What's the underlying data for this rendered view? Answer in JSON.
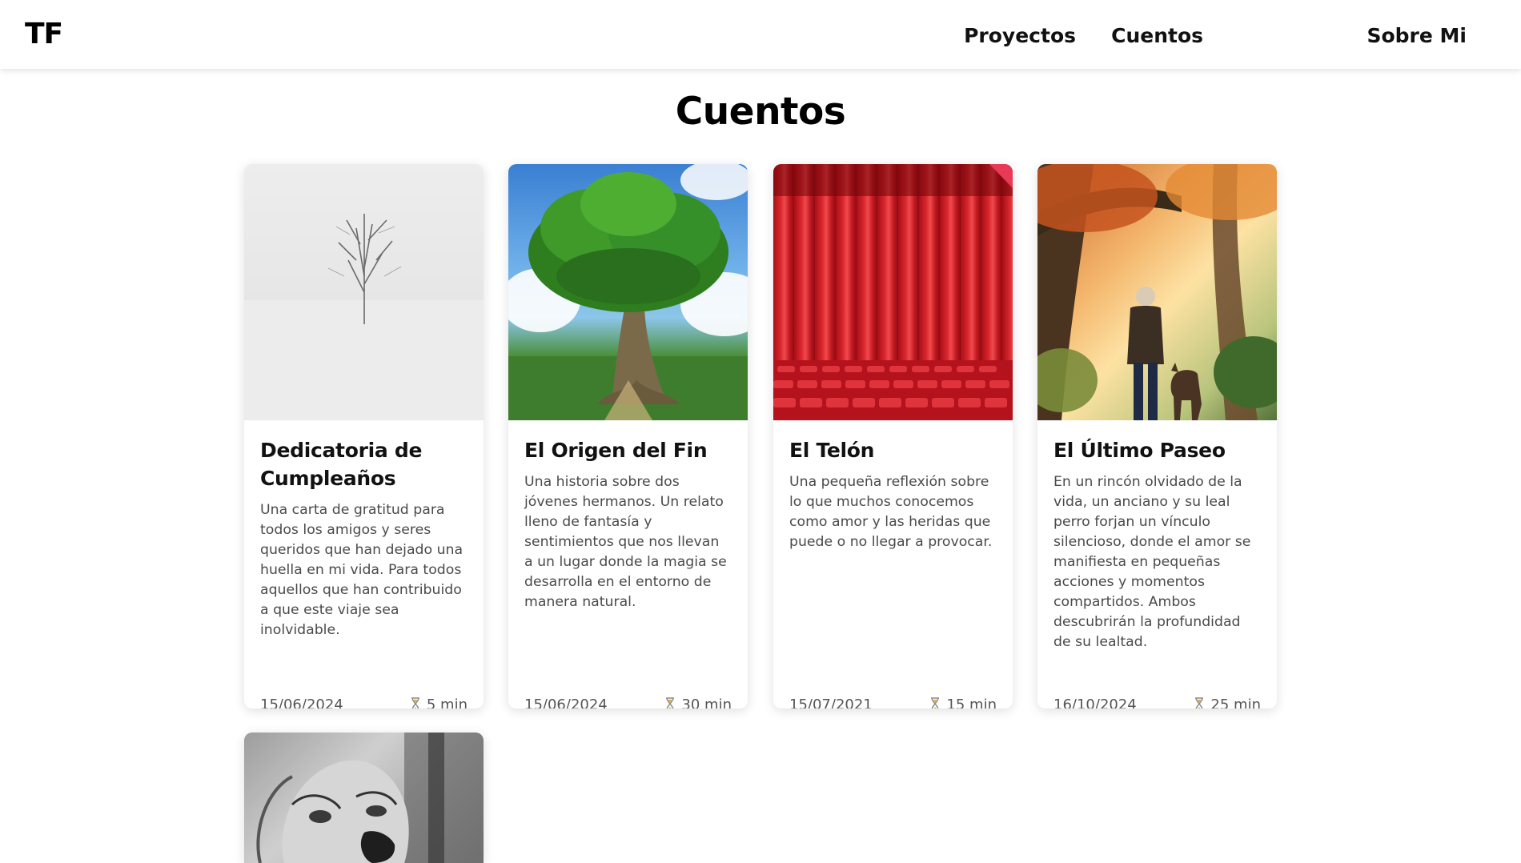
{
  "header": {
    "logo": "TF",
    "nav": [
      {
        "label": "Proyectos"
      },
      {
        "label": "Cuentos"
      },
      {
        "label": "Sobre Mi"
      }
    ]
  },
  "page": {
    "title": "Cuentos"
  },
  "cards": [
    {
      "title": "Dedicatoria de Cumpleaños",
      "description": "Una carta de gratitud para todos los amigos y seres queridos que han dejado una huella en mi vida. Para todos aquellos que han contribuido a que este viaje sea inolvidable.",
      "date": "15/06/2024",
      "duration": "5 min",
      "image": "snowy-tree"
    },
    {
      "title": "El Origen del Fin",
      "description": "Una historia sobre dos jóvenes hermanos. Un relato lleno de fantasía y sentimientos que nos llevan a un lugar donde la magia se desarrolla en el entorno de manera natural.",
      "date": "15/06/2024",
      "duration": "30 min",
      "image": "fantasy-tree"
    },
    {
      "title": "El Telón",
      "description": "Una pequeña reflexión sobre lo que muchos conocemos como amor y las heridas que puede o no llegar a provocar.",
      "date": "15/07/2021",
      "duration": "15 min",
      "image": "red-curtain"
    },
    {
      "title": "El Último Paseo",
      "description": "En un rincón olvidado de la vida, un anciano y su leal perro forjan un vínculo silencioso, donde el amor se manifiesta en pequeñas acciones y momentos compartidos. Ambos descubrirán la profundidad de su lealtad.",
      "date": "16/10/2024",
      "duration": "25 min",
      "image": "old-man-and-dog"
    },
    {
      "image": "screaming-face-sketch"
    }
  ]
}
